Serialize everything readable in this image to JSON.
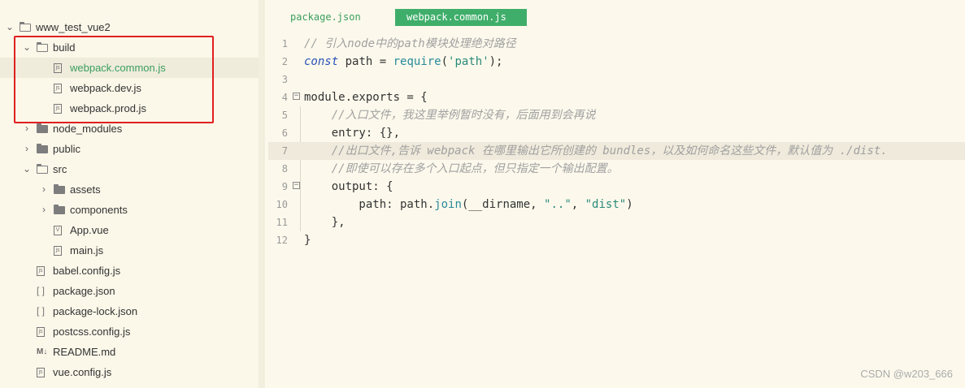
{
  "explorer": {
    "root": "www_test_vue2",
    "items": [
      {
        "label": "build",
        "kind": "folder",
        "open": true,
        "depth": 1
      },
      {
        "label": "webpack.common.js",
        "kind": "js",
        "depth": 2,
        "active": true
      },
      {
        "label": "webpack.dev.js",
        "kind": "js",
        "depth": 2
      },
      {
        "label": "webpack.prod.js",
        "kind": "js",
        "depth": 2
      },
      {
        "label": "node_modules",
        "kind": "folder",
        "open": false,
        "depth": 1
      },
      {
        "label": "public",
        "kind": "folder",
        "open": false,
        "depth": 1
      },
      {
        "label": "src",
        "kind": "folder",
        "open": true,
        "depth": 1
      },
      {
        "label": "assets",
        "kind": "folder",
        "open": false,
        "depth": 2
      },
      {
        "label": "components",
        "kind": "folder",
        "open": false,
        "depth": 2
      },
      {
        "label": "App.vue",
        "kind": "vue",
        "depth": 2
      },
      {
        "label": "main.js",
        "kind": "js",
        "depth": 2
      },
      {
        "label": "babel.config.js",
        "kind": "js",
        "depth": 1
      },
      {
        "label": "package.json",
        "kind": "json",
        "depth": 1
      },
      {
        "label": "package-lock.json",
        "kind": "json",
        "depth": 1
      },
      {
        "label": "postcss.config.js",
        "kind": "js",
        "depth": 1
      },
      {
        "label": "README.md",
        "kind": "md",
        "depth": 1
      },
      {
        "label": "vue.config.js",
        "kind": "js",
        "depth": 1
      }
    ]
  },
  "tabs": [
    {
      "label": "package.json",
      "active": false
    },
    {
      "label": "webpack.common.js",
      "active": true
    }
  ],
  "code_lines": [
    {
      "n": "1",
      "tokens": [
        [
          "c-comment",
          "// 引入node中的path模块处理绝对路径"
        ]
      ]
    },
    {
      "n": "2",
      "tokens": [
        [
          "c-kw",
          "const"
        ],
        [
          "c-plain",
          " path = "
        ],
        [
          "c-fn",
          "require"
        ],
        [
          "c-plain",
          "("
        ],
        [
          "c-str",
          "'path'"
        ],
        [
          "c-plain",
          ");"
        ]
      ]
    },
    {
      "n": "3",
      "tokens": []
    },
    {
      "n": "4",
      "fold": true,
      "tokens": [
        [
          "c-plain",
          "module.exports = {"
        ]
      ]
    },
    {
      "n": "5",
      "tokens": [
        [
          "c-comment",
          "    //入口文件，我这里举例暂时没有，后面用到会再说"
        ]
      ]
    },
    {
      "n": "6",
      "tokens": [
        [
          "c-plain",
          "    entry: {},"
        ]
      ]
    },
    {
      "n": "7",
      "current": true,
      "tokens": [
        [
          "c-comment",
          "    //出口文件,告诉 webpack 在哪里输出它所创建的 bundles，以及如何命名这些文件，默认值为 ./dist."
        ]
      ]
    },
    {
      "n": "8",
      "tokens": [
        [
          "c-comment",
          "    //即使可以存在多个入口起点，但只指定一个输出配置。"
        ]
      ]
    },
    {
      "n": "9",
      "fold": true,
      "tokens": [
        [
          "c-plain",
          "    output: {"
        ]
      ]
    },
    {
      "n": "10",
      "tokens": [
        [
          "c-plain",
          "        path: path."
        ],
        [
          "c-fn",
          "join"
        ],
        [
          "c-plain",
          "(__dirname, "
        ],
        [
          "c-str",
          "\"..\""
        ],
        [
          "c-plain",
          ", "
        ],
        [
          "c-str",
          "\"dist\""
        ],
        [
          "c-plain",
          ")"
        ]
      ]
    },
    {
      "n": "11",
      "tokens": [
        [
          "c-plain",
          "    },"
        ]
      ]
    },
    {
      "n": "12",
      "tokens": [
        [
          "c-plain",
          "}"
        ]
      ]
    }
  ],
  "watermark": "CSDN @w203_666"
}
